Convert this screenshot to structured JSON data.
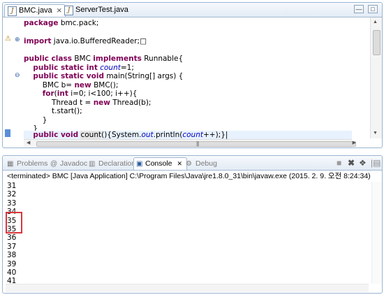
{
  "editor": {
    "tabs": [
      {
        "label": "BMC.java",
        "close": "⨯",
        "icon": "java-file-icon"
      },
      {
        "label": "ServerTest.java",
        "icon": "java-file-icon"
      }
    ],
    "window_buttons": [
      "minimize",
      "maximize"
    ],
    "code_lines": [
      "package bmc.pack;",
      "",
      "import java.io.BufferedReader;",
      "",
      "public class BMC implements Runnable{",
      "    public static int count=1;",
      "    public static void main(String[] args) {",
      "        BMC b= new BMC();",
      "        for(int i=0; i<100; i++){",
      "            Thread t = new Thread(b);",
      "            t.start();",
      "        }",
      "    }",
      "    public void count(){System.out.println(count++);}"
    ]
  },
  "console": {
    "tabs": [
      {
        "label": "Problems",
        "icon": "problems-icon"
      },
      {
        "label": "Javadoc",
        "icon": "at-icon"
      },
      {
        "label": "Declaration",
        "icon": "declaration-icon"
      },
      {
        "label": "Console",
        "icon": "console-icon",
        "active": true
      },
      {
        "label": "Debug",
        "icon": "debug-icon"
      }
    ],
    "toolbar": [
      "terminate-icon",
      "remove-launch-icon",
      "remove-all-icon",
      "scroll-lock-icon"
    ],
    "terminated_line": "<terminated> BMC [Java Application] C:\\Program Files\\Java\\jre1.8.0_31\\bin\\javaw.exe (2015. 2. 9. 오전 8:24:34)",
    "output": [
      "31",
      "32",
      "33",
      "34",
      "35",
      "35",
      "36",
      "37",
      "38",
      "39",
      "40",
      "41"
    ],
    "highlight_color": "#d9363e"
  }
}
